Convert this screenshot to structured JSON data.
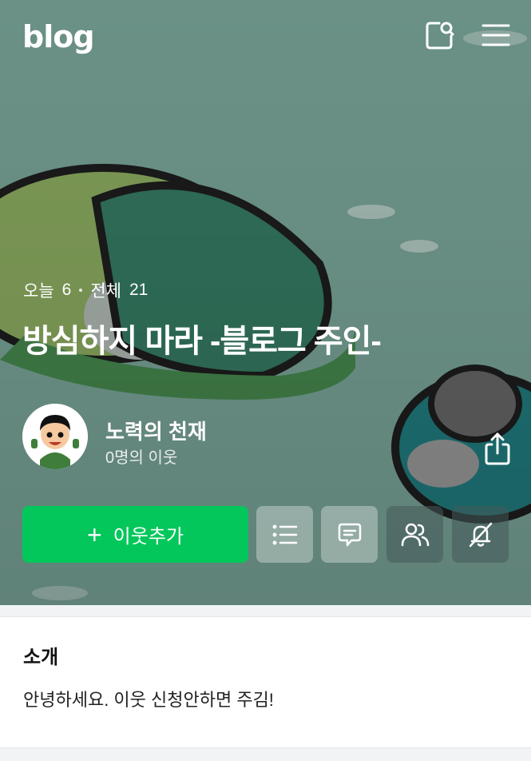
{
  "header": {
    "logo": "blog",
    "icons": {
      "search": "search-icon",
      "menu": "menu-icon"
    }
  },
  "stats": {
    "today_label": "오늘",
    "today": "6",
    "total_label": "전체",
    "total": "21"
  },
  "blog_title": "방심하지 마라 -블로그 주인-",
  "profile": {
    "nickname": "노력의 천재",
    "neighbors": "0명의 이웃"
  },
  "actions": {
    "add_neighbor": "이웃추가",
    "icons": [
      "list-icon",
      "comment-icon",
      "neighbors-icon",
      "no-notification-icon",
      "share-icon"
    ]
  },
  "intro": {
    "heading": "소개",
    "text": "안녕하세요. 이웃 신청안하면 주김!"
  },
  "colors": {
    "accent": "#03c75a",
    "hero_bg": "#6d9489",
    "page_bg": "#f2f3f5"
  }
}
